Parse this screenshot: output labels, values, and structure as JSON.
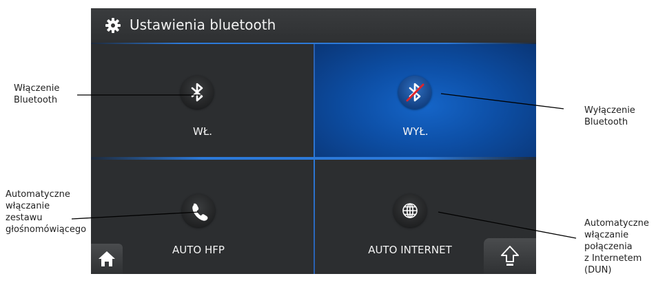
{
  "window": {
    "title": "Ustawienia bluetooth",
    "title_icon": "gear-icon"
  },
  "tiles": {
    "on": {
      "label": "WŁ.",
      "icon": "bluetooth-icon"
    },
    "off": {
      "label": "WYŁ.",
      "icon": "bluetooth-off-icon",
      "selected": true
    },
    "hfp": {
      "label": "AUTO HFP",
      "icon": "phone-icon"
    },
    "net": {
      "label": "AUTO INTERNET",
      "icon": "globe-icon"
    }
  },
  "nav": {
    "home_icon": "home-icon",
    "back_icon": "up-arrow-icon"
  },
  "annotations": {
    "bt_on": [
      "Włączenie",
      "Bluetooth"
    ],
    "bt_off": [
      "Wyłączenie",
      "Bluetooth"
    ],
    "hfp": [
      "Automatyczne",
      "włączanie",
      "zestawu",
      "głośnomówiącego"
    ],
    "dun": [
      "Automatyczne",
      "włączanie",
      "połączenia",
      "z Internetem",
      "(DUN)"
    ]
  },
  "colors": {
    "accent": "#1565c8",
    "panel": "#2c2e30",
    "title_text": "#f2f2f2"
  }
}
